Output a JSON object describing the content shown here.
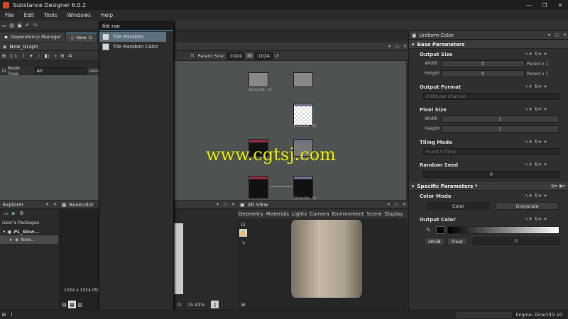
{
  "app": {
    "title": "Substance Designer 6.0.2"
  },
  "menu": [
    "File",
    "Edit",
    "Tools",
    "Windows",
    "Help"
  ],
  "tabs": {
    "dependency_manager": "Dependency Manager",
    "new_graph_short": "New_G"
  },
  "graph": {
    "title": "New_Graph",
    "zoom": "1:1",
    "node_type_label": "Node Type",
    "node_type_value": "All",
    "using_label": "Usin",
    "parent_size_label": "Parent Size:",
    "parent_size_value": "1024",
    "size_value": "1024",
    "node_labels": [
      "1024x1024 - C8",
      "1024x1024 - C8",
      "1024x1024 - C8",
      "1024x1024 - C8"
    ]
  },
  "search": {
    "query": "tile ran",
    "results": [
      "Tile Random",
      "Tile Random Color"
    ]
  },
  "explorer": {
    "title": "Explorer",
    "user_packages": "User's Packages",
    "package": "PL_Ston...",
    "graph_item": "New..."
  },
  "basecolor": {
    "title": "Basecolor",
    "info": "1024 x 1024 (RG"
  },
  "view2d": {
    "zoom": "15.92%"
  },
  "view3d": {
    "title": "3D View",
    "menu": [
      "Geometry",
      "Materials",
      "Lights",
      "Camera",
      "Environment",
      "Scene",
      "Display"
    ]
  },
  "properties": {
    "title": "Uniform Color",
    "base_section": "Base Parameters",
    "output_size": {
      "label": "Output Size",
      "width_label": "Width",
      "height_label": "Height",
      "width_value": "0",
      "height_value": "0",
      "width_mode": "Parent x 1",
      "height_mode": "Parent x 1"
    },
    "output_format": {
      "label": "Output Format",
      "value": "8 Bits per Channel"
    },
    "pixel_size": {
      "label": "Pixel Size",
      "width_label": "Width",
      "height_label": "Height",
      "width_value": "1",
      "height_value": "1"
    },
    "tiling_mode": {
      "label": "Tiling Mode",
      "value": "H and V Tiling"
    },
    "random_seed": {
      "label": "Random Seed",
      "value": "0"
    },
    "specific_section": "Specific Parameters *",
    "color_mode": {
      "label": "Color Mode",
      "options": [
        "Color",
        "Grayscale"
      ],
      "selected": "Grayscale"
    },
    "output_color": {
      "label": "Output Color",
      "space": "sRGB",
      "type": "Float",
      "value": "0"
    }
  },
  "status": {
    "engine": "Engine: Direct3D 10"
  },
  "watermark": "www.cgtsj.com",
  "colors": {
    "accent": "#4da3d8",
    "selection": "#5c6f7f",
    "graph_bg": "#4d5351",
    "watermark": "#e6e600"
  }
}
